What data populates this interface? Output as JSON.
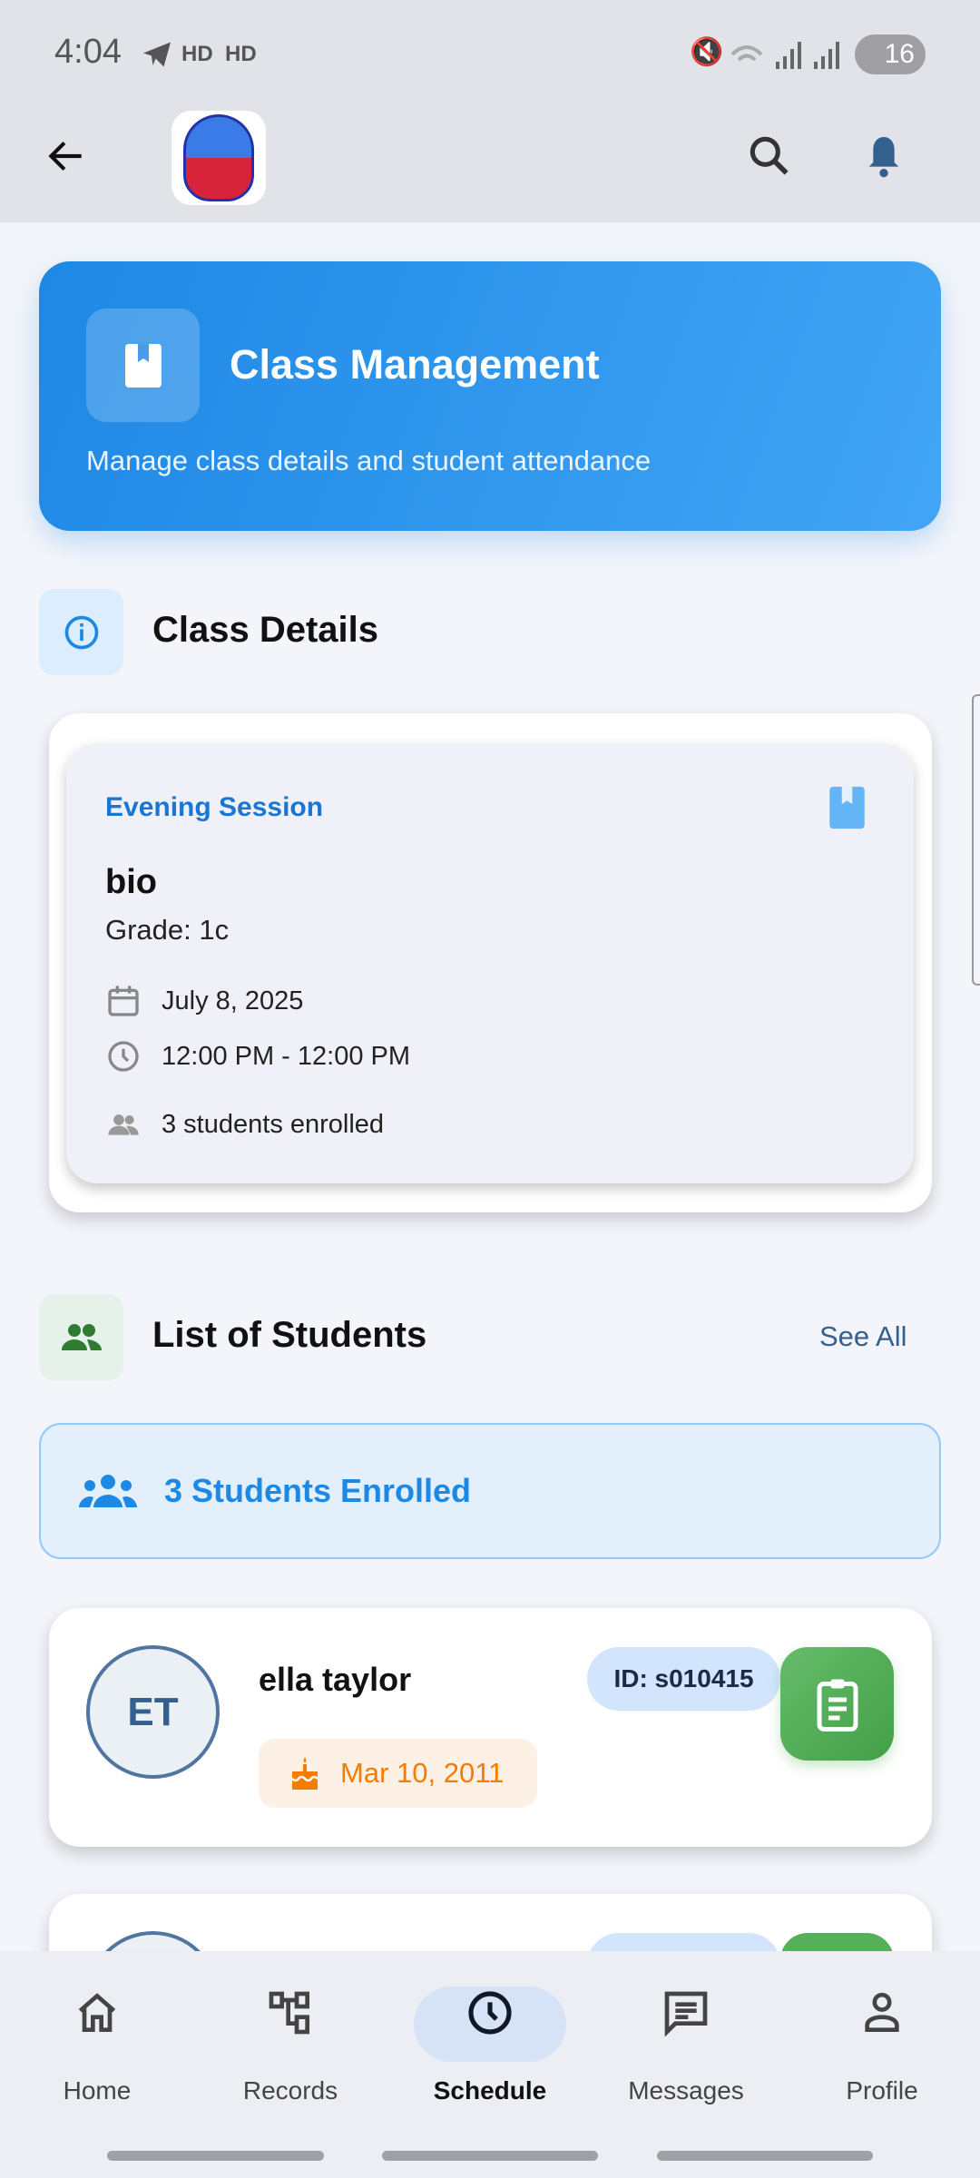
{
  "status_bar": {
    "time": "4:04",
    "hd1": "HD",
    "hd2": "HD",
    "battery": "16"
  },
  "app_bar": {
    "back": "arrow-back-icon",
    "logo": "school-logo",
    "search": "search-icon",
    "notifications": "bell-icon"
  },
  "header": {
    "title": "Class Management",
    "subtitle": "Manage class details and student attendance"
  },
  "class_details": {
    "title": "Class Details",
    "session": "Evening Session",
    "subject": "bio",
    "grade": "Grade: 1c",
    "date": "July 8, 2025",
    "time": "12:00 PM - 12:00 PM",
    "enrolled": "3 students enrolled"
  },
  "students": {
    "title": "List of Students",
    "see_all": "See All",
    "banner": "3 Students Enrolled",
    "items": [
      {
        "initials": "ET",
        "name": "ella taylor",
        "id": "ID: s010415",
        "dob": "Mar 10, 2011"
      }
    ]
  },
  "nav": {
    "items": [
      {
        "label": "Home"
      },
      {
        "label": "Records"
      },
      {
        "label": "Schedule"
      },
      {
        "label": "Messages"
      },
      {
        "label": "Profile"
      }
    ],
    "active": "Schedule"
  },
  "colors": {
    "primary": "#1e88e5",
    "green": "#4caf50",
    "orange": "#f57c00"
  }
}
